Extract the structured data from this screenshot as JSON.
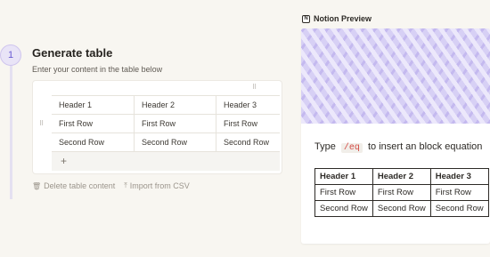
{
  "step": {
    "number": "1",
    "title": "Generate table",
    "subtitle": "Enter your content in the table below"
  },
  "editor": {
    "column_handle_icon": "drag-handle-icon",
    "row_handle_icon": "drag-handle-icon",
    "headers": [
      "Header 1",
      "Header 2",
      "Header 3"
    ],
    "rows": [
      [
        "First Row",
        "First Row",
        "First Row"
      ],
      [
        "Second Row",
        "Second Row",
        "Second Row"
      ]
    ],
    "add_row_label": "+"
  },
  "actions": {
    "delete_label": "Delete table content",
    "delete_icon": "trash-icon",
    "import_label": "Import from CSV",
    "import_icon": "upload-icon"
  },
  "preview": {
    "label": "Notion Preview",
    "icon": "notion-icon",
    "cover_color": "#d7d0f5",
    "eq_prefix": "Type",
    "eq_code": "/eq",
    "eq_suffix": "to insert an block equation",
    "table": {
      "headers": [
        "Header 1",
        "Header 2",
        "Header 3"
      ],
      "rows": [
        [
          "First Row",
          "First Row",
          "First Row"
        ],
        [
          "Second Row",
          "Second Row",
          "Second Row"
        ]
      ]
    }
  },
  "colors": {
    "accent": "#6b5bd2",
    "code_text": "#d44c47",
    "background": "#f8f6f1"
  }
}
